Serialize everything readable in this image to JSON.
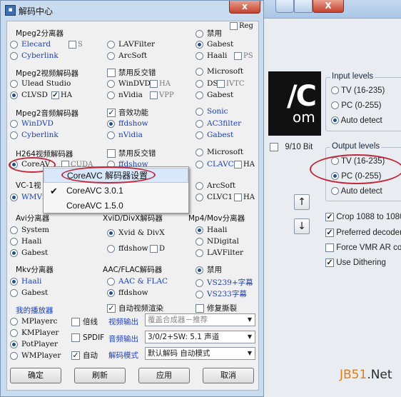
{
  "dialog": {
    "title": "解码中心",
    "close_glyph": "x",
    "sections": {
      "mpeg2_splitter": {
        "label": "Mpeg2分离器",
        "options": [
          "Elecard",
          "LAVFilter",
          "禁用",
          "Cyberlink",
          "ArcSoft",
          "Gabest",
          "Haali"
        ],
        "mini_checks": [
          "S",
          "PS"
        ]
      },
      "mpeg2_video": {
        "label": "Mpeg2视频解码器",
        "checkbox": "禁用反交错",
        "options": [
          "Microsoft",
          "Ulead Studio",
          "WinDVD",
          "DS",
          "CLVSD",
          "nVidia",
          "Gabest"
        ],
        "mini_checks": [
          "HA",
          "HA",
          "IVTC",
          "VPP"
        ]
      },
      "mpeg2_audio": {
        "label": "Mpeg2音频解码器",
        "checkbox": "音效功能",
        "options": [
          "Sonic",
          "WinDVD",
          "ffdshow",
          "AC3filter",
          "Cyberlink",
          "nVidia",
          "Gabest"
        ]
      },
      "h264_video": {
        "label": "H264视频解码器",
        "checkbox": "禁用反交错",
        "options": [
          "Microsoft",
          "CoreAV",
          "ffdshow",
          "CLAVC"
        ],
        "mini_checks": [
          "CUDA",
          "HA"
        ]
      },
      "vc1_video": {
        "label": "VC-1视",
        "options": [
          "WMVi",
          "ArcSoft",
          "CLVC1"
        ],
        "mini_checks": [
          "HA"
        ]
      },
      "avi_splitter": {
        "label": "Avi分离器",
        "options": [
          "System",
          "Haali",
          "Gabest"
        ]
      },
      "xvid_divx": {
        "label": "XviD/DivX解码器",
        "options": [
          "Xvid & DivX",
          "ffdshow"
        ],
        "mini_checks": [
          "D"
        ]
      },
      "mp4_splitter": {
        "label": "Mp4/Mov分离器",
        "options": [
          "Haali",
          "NDigital",
          "LAVFilter"
        ]
      },
      "mkv_splitter": {
        "label": "Mkv分离器",
        "options": [
          "Haali",
          "Gabest"
        ]
      },
      "aac_flac": {
        "label": "AAC/FLAC解码器",
        "options": [
          "AAC & FLAC",
          "ffdshow"
        ]
      },
      "extra": {
        "disable": "禁用",
        "vs239": "VS239+字幕",
        "vs233": "VS233字幕",
        "reg": "Reg",
        "auto_video_render": "自动视频渲染",
        "fix_tearing": "修复撕裂"
      },
      "my_players": {
        "label": "我的播放器",
        "options": [
          "MPlayerc",
          "KMPlayer",
          "PotPlayer",
          "WMPlayer"
        ]
      },
      "output": {
        "double_speed": "倍线",
        "video_out_label": "视频输出",
        "video_out_value": "覆盖合成器－推荐",
        "spdif": "SPDIF",
        "audio_out_label": "音频输出",
        "audio_out_value": "3/0/2+SW: 5.1 声道",
        "auto": "自动",
        "decode_mode_label": "解码模式",
        "decode_mode_value": "默认解码 自动模式"
      }
    },
    "buttons": {
      "ok": "确定",
      "refresh": "刷新",
      "apply": "应用",
      "cancel": "取消"
    }
  },
  "context_menu": {
    "items": [
      "CoreAVC 解码器设置",
      "CoreAVC 3.0.1",
      "CoreAVC 1.5.0"
    ],
    "checked_index": 1
  },
  "background_window": {
    "logo_text_1": "/C",
    "logo_text_2": "om",
    "bit_label": "9/10 Bit",
    "input_levels": {
      "label": "Input levels",
      "options": [
        "TV (16-235)",
        "PC (0-255)",
        "Auto detect"
      ],
      "selected": 2
    },
    "output_levels": {
      "label": "Output levels",
      "options": [
        "TV (16-235)",
        "PC (0-255)",
        "Auto detect"
      ],
      "selected": 1
    },
    "checkboxes": [
      {
        "label": "Crop 1088 to 1080",
        "checked": true
      },
      {
        "label": "Preferred decoder",
        "checked": true
      },
      {
        "label": "Force VMR AR cor",
        "checked": false
      },
      {
        "label": "Use Dithering",
        "checked": true
      }
    ],
    "arrow_up": "↑",
    "arrow_down": "↓",
    "close_glyph": "X"
  },
  "watermark": {
    "part1": "JB51",
    "part2": ".Net"
  }
}
